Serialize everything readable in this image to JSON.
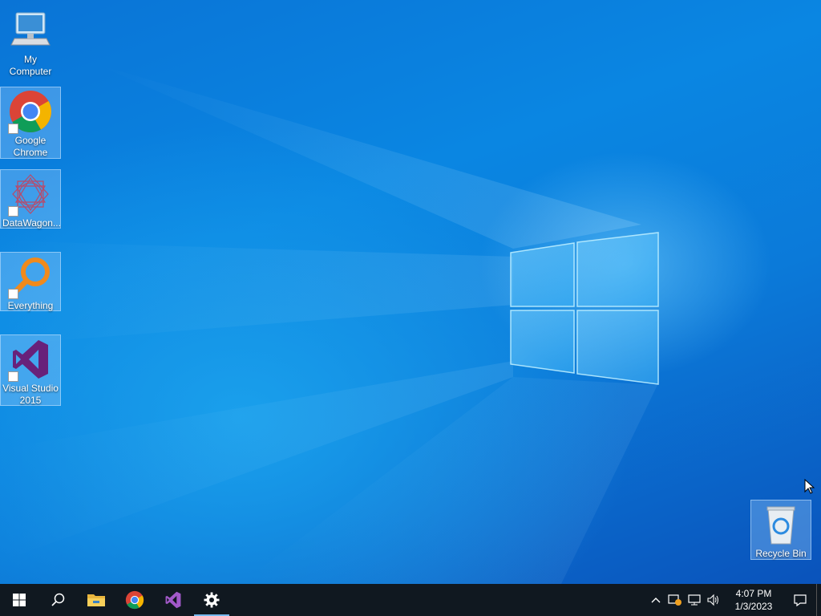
{
  "desktop": {
    "icons": [
      {
        "label": "My Computer",
        "icon": "computer-icon",
        "shortcut": false
      },
      {
        "label": "Google Chrome",
        "icon": "chrome-icon",
        "shortcut": true
      },
      {
        "label": "DataWagon...",
        "icon": "datawagon-icon",
        "shortcut": true
      },
      {
        "label": "Everything",
        "icon": "everything-icon",
        "shortcut": true
      },
      {
        "label": "Visual Studio 2015",
        "icon": "visual-studio-icon",
        "shortcut": true
      },
      {
        "label": "Recycle Bin",
        "icon": "recycle-bin-icon",
        "shortcut": false
      }
    ]
  },
  "taskbar": {
    "buttons": [
      "start-icon",
      "search-icon",
      "file-explorer-icon",
      "chrome-icon",
      "visual-studio-icon",
      "settings-icon"
    ],
    "active": "settings-icon",
    "tray_icons": [
      "chevron-up-icon",
      "security-alert-icon",
      "network-icon",
      "volume-icon"
    ],
    "clock": {
      "time": "4:07 PM",
      "date": "1/3/2023"
    }
  },
  "colors": {
    "taskbar": "#101820",
    "accent": "#76b9ed",
    "desktop_top": "#0a74d6",
    "desktop_bottom": "#0a4fb8"
  }
}
